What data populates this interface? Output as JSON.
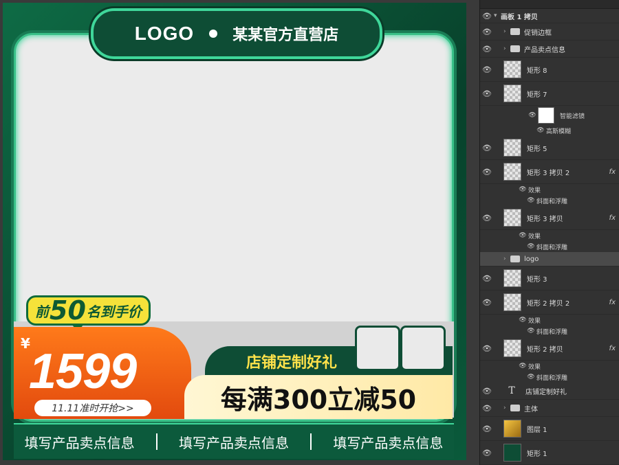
{
  "canvas": {
    "header": {
      "logo": "LOGO",
      "store": "某某官方直营店"
    },
    "badge": {
      "prefix": "前",
      "number": "50",
      "suffix": "名到手价"
    },
    "price": {
      "currency": "¥",
      "value": "1599",
      "presale": "11.11准时开抢>>"
    },
    "gift": {
      "text": "店铺定制好礼"
    },
    "deal": {
      "text": "每满300立减50"
    },
    "footer": {
      "items": [
        "填写产品卖点信息",
        "填写产品卖点信息",
        "填写产品卖点信息"
      ]
    }
  },
  "panel": {
    "header": "画板 1 拷贝",
    "layers": [
      {
        "name": "促销边框"
      },
      {
        "name": "产品卖点信息"
      },
      {
        "name": "矩形 8"
      },
      {
        "name": "矩形 7",
        "subs": [
          "智能滤镜",
          "高斯模糊"
        ]
      },
      {
        "name": "矩形 5"
      },
      {
        "name": "矩形 3 拷贝 2",
        "fx": "fx",
        "subs": [
          "效果",
          "斜面和浮雕"
        ]
      },
      {
        "name": "矩形 3 拷贝",
        "fx": "fx",
        "subs": [
          "效果",
          "斜面和浮雕"
        ]
      },
      {
        "name": "logo"
      },
      {
        "name": "矩形 3"
      },
      {
        "name": "矩形 2 拷贝 2",
        "fx": "fx",
        "subs": [
          "效果",
          "斜面和浮雕"
        ]
      },
      {
        "name": "矩形 2 拷贝",
        "fx": "fx",
        "subs": [
          "效果",
          "斜面和浮雕"
        ]
      },
      {
        "name": "店铺定制好礼"
      },
      {
        "name": "主体"
      },
      {
        "name": "图层 1"
      },
      {
        "name": "矩形 1"
      }
    ]
  }
}
